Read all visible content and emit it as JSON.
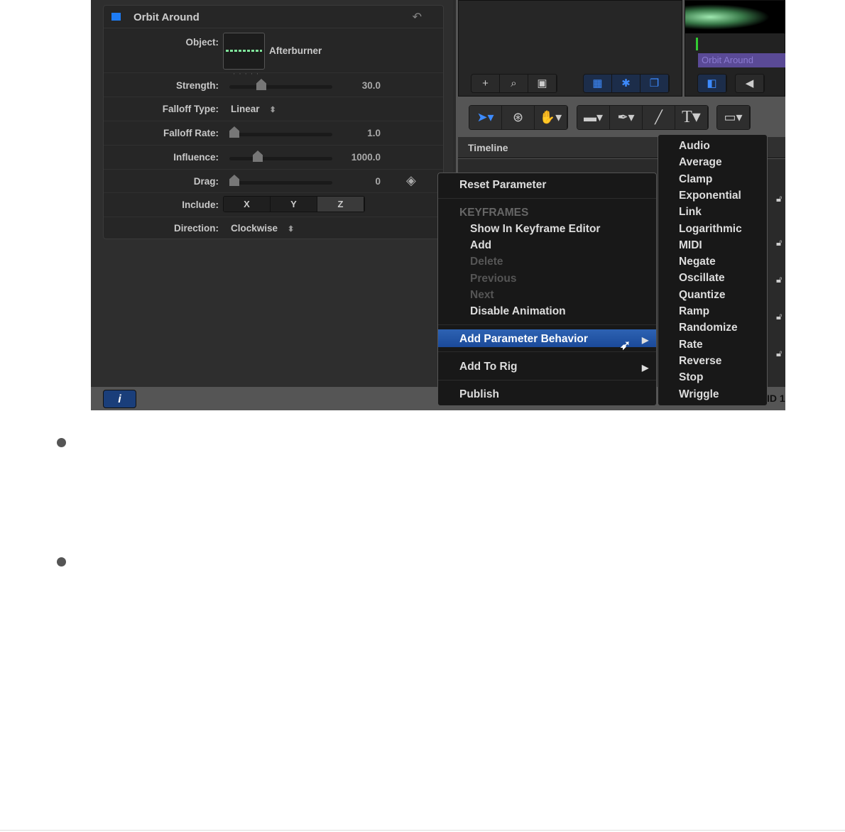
{
  "inspector": {
    "title": "Orbit Around",
    "rows": [
      {
        "label": "Object:",
        "value": "Afterburner"
      },
      {
        "label": "Strength:",
        "value": "30.0",
        "fraction": 0.25
      },
      {
        "label": "Falloff Type:",
        "value": "Linear"
      },
      {
        "label": "Falloff Rate:",
        "value": "1.0",
        "fraction": 0
      },
      {
        "label": "Influence:",
        "value": "1000.0",
        "fraction": 0.2
      },
      {
        "label": "Drag:",
        "value": "0",
        "fraction": 0
      },
      {
        "label": "Include:",
        "options": [
          "X",
          "Y",
          "Z"
        ]
      },
      {
        "label": "Direction:",
        "value": "Clockwise"
      }
    ]
  },
  "preview": {
    "clip_label": "Orbit Around"
  },
  "timeline": {
    "title": "Timeline"
  },
  "context_menu": {
    "reset": "Reset Parameter",
    "keyframes_header": "KEYFRAMES",
    "show": "Show In Keyframe Editor",
    "add": "Add",
    "delete": "Delete",
    "previous": "Previous",
    "next": "Next",
    "disable": "Disable Animation",
    "add_behavior": "Add Parameter Behavior",
    "add_rig": "Add To Rig",
    "publish": "Publish"
  },
  "submenu": [
    "Audio",
    "Average",
    "Clamp",
    "Exponential",
    "Link",
    "Logarithmic",
    "MIDI",
    "Negate",
    "Oscillate",
    "Quantize",
    "Ramp",
    "Randomize",
    "Rate",
    "Reverse",
    "Stop",
    "Wriggle"
  ],
  "status": {
    "info_label": "i",
    "partial_text": "ID 1"
  },
  "colors": {
    "accent": "#1e7cf5",
    "highlight": "#2d62b3",
    "clip": "#5a4a96"
  }
}
